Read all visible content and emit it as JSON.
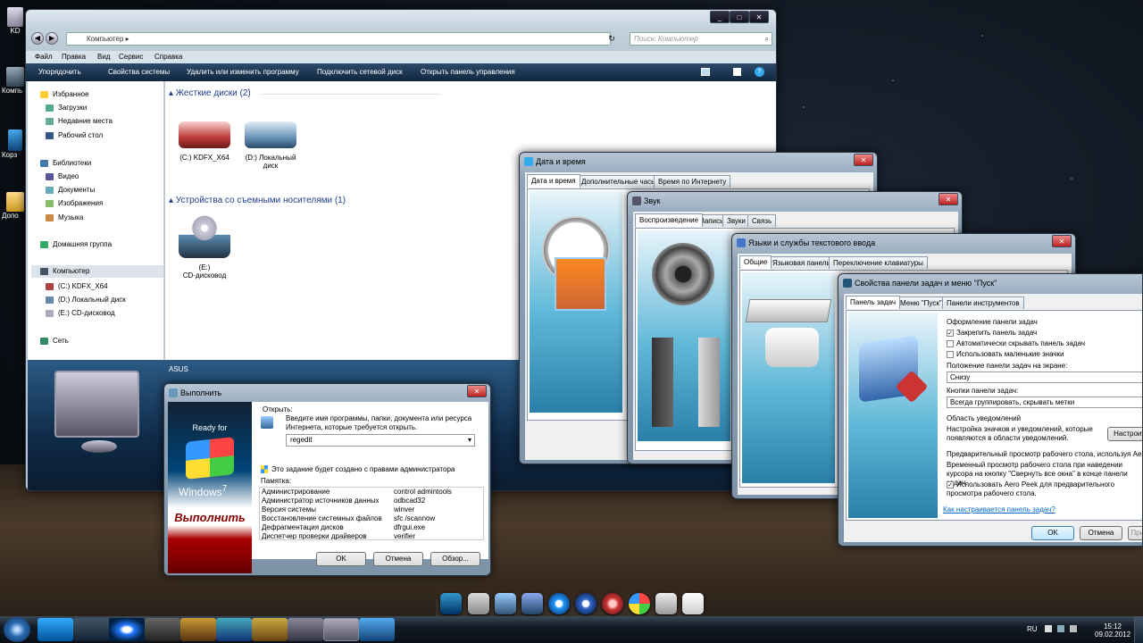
{
  "desktop": {
    "icons": [
      {
        "label": "KD"
      },
      {
        "label": "Компь"
      },
      {
        "label": "Корз"
      },
      {
        "label": "Допо"
      }
    ]
  },
  "explorer": {
    "address": "Компьютер",
    "search_placeholder": "Поиск: Компьютер",
    "menu": [
      "Файл",
      "Правка",
      "Вид",
      "Сервис",
      "Справка"
    ],
    "toolbar": [
      "Упорядочить",
      "Свойства системы",
      "Удалить или изменить программу",
      "Подключить сетевой диск",
      "Открыть панель управления"
    ],
    "nav": {
      "favorites": "Избранное",
      "downloads": "Загрузки",
      "recent": "Недавние места",
      "desktop": "Рабочий стол",
      "libraries": "Библиотеки",
      "video": "Видео",
      "docs": "Документы",
      "images": "Изображения",
      "music": "Музыка",
      "homegroup": "Домашняя группа",
      "computer": "Компьютер",
      "drive_c": "(C:) KDFX_X64",
      "drive_d": "(D:) Локальный диск",
      "drive_e": "(E:) CD-дисковод",
      "network": "Сеть"
    },
    "groups": {
      "hdd": "Жесткие диски (2)",
      "removable": "Устройства со съемными носителями (1)"
    },
    "drives": {
      "c": "(C:) KDFX_X64",
      "d_line1": "(D:) Локальный",
      "d_line2": "диск",
      "e_line1": "(E:)",
      "e_line2": "CD-дисковод"
    },
    "details": "ASUS"
  },
  "run": {
    "title": "Выполнить",
    "brand_top": "Ready for",
    "brand_win": "Windows",
    "brand_ver": "7",
    "brand_run": "Выполнить",
    "open_label": "Открыть:",
    "desc": "Введите имя программы, папки, документа или ресурса Интернета, которые требуется открыть.",
    "value": "regedit",
    "admin_note": "Это задание будет создано с правами администратора",
    "memo_label": "Памятка:",
    "memo": [
      [
        "Администрирование",
        "control admintools"
      ],
      [
        "Администратор источников данных",
        "odbcad32"
      ],
      [
        "Версия системы",
        "winver"
      ],
      [
        "Восстановление системных файлов",
        "sfc /scannow"
      ],
      [
        "Дефрагментация дисков",
        "dfrgui.exe"
      ],
      [
        "Диспетчер проверки драйверов",
        "verifier"
      ]
    ],
    "ok": "OK",
    "cancel": "Отмена",
    "browse": "Обзор..."
  },
  "datetime": {
    "title": "Дата и время",
    "tabs": [
      "Дата и время",
      "Дополнительные часы",
      "Время по Интернету"
    ]
  },
  "sound": {
    "title": "Звук",
    "tabs": [
      "Воспроизведение",
      "Запись",
      "Звуки",
      "Связь"
    ]
  },
  "lang": {
    "title": "Языки и службы текстового ввода",
    "tabs": [
      "Общие",
      "Языковая панель",
      "Переключение клавиатуры"
    ]
  },
  "taskbar_props": {
    "title": "Свойства панели задач и меню \"Пуск\"",
    "tabs": [
      "Панель задач",
      "Меню \"Пуск\"",
      "Панели инструментов"
    ],
    "appearance": "Оформление панели задач",
    "lock": "Закрепить панель задач",
    "autohide": "Автоматически скрывать панель задач",
    "small": "Использовать маленькие значки",
    "position_label": "Положение панели задач на экране:",
    "position_value": "Снизу",
    "buttons_label": "Кнопки панели задач:",
    "buttons_value": "Всегда группировать, скрывать метки",
    "notif_label": "Область уведомлений",
    "notif_desc": "Настройка значков и уведомлений, которые появляются в области уведомлений.",
    "configure": "Настроить...",
    "peek_label": "Предварительный просмотр рабочего стола, используя Aero Peek",
    "peek_desc": "Временный просмотр рабочего стола при наведении курсора на кнопку \"Свернуть все окна\" в конце панели задач.",
    "peek_check": "Использовать Aero Peek для предварительного просмотра рабочего стола.",
    "link": "Как настраивается панель задач?",
    "ok": "OK",
    "cancel": "Отмена",
    "apply": "Применить"
  },
  "taskbar": {
    "lang": "RU",
    "time": "15:12",
    "date": "09.02.2012"
  }
}
